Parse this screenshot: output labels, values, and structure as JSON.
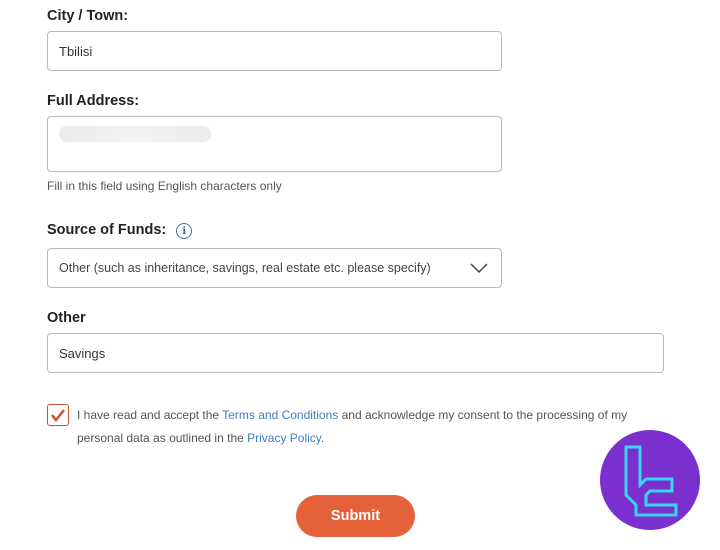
{
  "form": {
    "city_label": "City / Town:",
    "city_value": "Tbilisi",
    "address_label": "Full Address:",
    "address_help": "Fill in this field using English characters only",
    "funds_label": "Source of Funds:",
    "funds_selected": "Other (such as inheritance, savings, real estate etc. please specify)",
    "other_label": "Other",
    "other_value": "Savings",
    "consent": {
      "checked": true,
      "text_1": "I have read and accept the ",
      "terms_link": "Terms and Conditions",
      "text_2": " and acknowledge my consent to the processing of my personal data as outlined in the ",
      "privacy_link": "Privacy Policy",
      "text_3": "."
    },
    "submit_label": "Submit"
  },
  "colors": {
    "accent": "#e5613a",
    "link": "#3c7fc6",
    "logo_bg": "#7b2fcf",
    "logo_mark": "#34d6f0"
  },
  "icons": {
    "info": "info-icon",
    "dropdown": "chevron-down-icon",
    "check": "check-icon",
    "logo": "brand-logo"
  }
}
